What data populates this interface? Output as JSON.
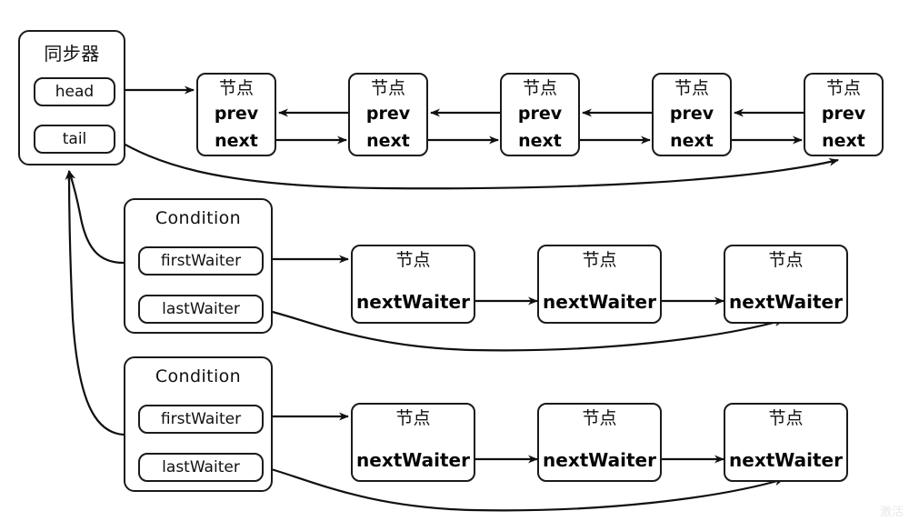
{
  "diagram": {
    "title_watermark": "激活",
    "synchronizer": {
      "title": "同步器",
      "slots": [
        {
          "id": "head",
          "label": "head"
        },
        {
          "id": "tail",
          "label": "tail"
        }
      ]
    },
    "queue": {
      "node_title": "节点",
      "fields": {
        "prev": "prev",
        "next": "next"
      },
      "nodes": [
        {
          "title": "节点",
          "prev": "prev",
          "next": "next"
        },
        {
          "title": "节点",
          "prev": "prev",
          "next": "next"
        },
        {
          "title": "节点",
          "prev": "prev",
          "next": "next"
        },
        {
          "title": "节点",
          "prev": "prev",
          "next": "next"
        },
        {
          "title": "节点",
          "prev": "prev",
          "next": "next"
        }
      ]
    },
    "conditions": [
      {
        "title": "Condition",
        "slots": [
          {
            "id": "firstWaiter",
            "label": "firstWaiter"
          },
          {
            "id": "lastWaiter",
            "label": "lastWaiter"
          }
        ],
        "waiters": [
          {
            "title": "节点",
            "field": "nextWaiter"
          },
          {
            "title": "节点",
            "field": "nextWaiter"
          },
          {
            "title": "节点",
            "field": "nextWaiter"
          }
        ]
      },
      {
        "title": "Condition",
        "slots": [
          {
            "id": "firstWaiter",
            "label": "firstWaiter"
          },
          {
            "id": "lastWaiter",
            "label": "lastWaiter"
          }
        ],
        "waiters": [
          {
            "title": "节点",
            "field": "nextWaiter"
          },
          {
            "title": "节点",
            "field": "nextWaiter"
          },
          {
            "title": "节点",
            "field": "nextWaiter"
          }
        ]
      }
    ],
    "colors": {
      "stroke": "#1a1a1a",
      "background": "#ffffff",
      "text": "#111111"
    }
  }
}
